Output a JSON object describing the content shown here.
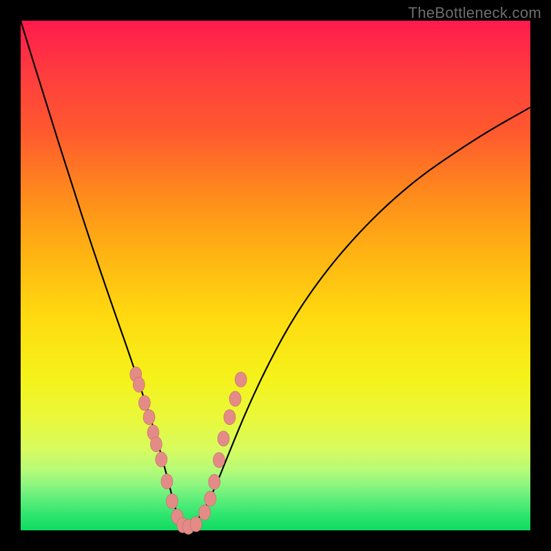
{
  "watermark": "TheBottleneck.com",
  "colors": {
    "frame": "#000000",
    "curve": "#000000",
    "marker_fill": "#e58b87",
    "marker_stroke": "#b66e6a",
    "gradient_top": "#ff1a4d",
    "gradient_bottom": "#0fdb61"
  },
  "chart_data": {
    "type": "line",
    "title": "",
    "xlabel": "",
    "ylabel": "",
    "x_range": [
      0,
      1
    ],
    "y_range": [
      0,
      1
    ],
    "series": [
      {
        "name": "bottleneck-curve",
        "x": [
          0.0,
          0.05,
          0.1,
          0.14,
          0.18,
          0.21,
          0.232,
          0.25,
          0.265,
          0.278,
          0.29,
          0.3,
          0.31,
          0.32,
          0.335,
          0.355,
          0.38,
          0.41,
          0.445,
          0.49,
          0.54,
          0.6,
          0.66,
          0.72,
          0.785,
          0.85,
          0.92,
          1.0
        ],
        "y": [
          1.0,
          0.838,
          0.68,
          0.557,
          0.44,
          0.355,
          0.29,
          0.235,
          0.187,
          0.14,
          0.095,
          0.055,
          0.022,
          0.008,
          0.008,
          0.03,
          0.08,
          0.155,
          0.24,
          0.335,
          0.425,
          0.51,
          0.58,
          0.64,
          0.695,
          0.74,
          0.785,
          0.83
        ]
      }
    ],
    "markers": {
      "name": "highlight-points",
      "x": [
        0.226,
        0.232,
        0.243,
        0.252,
        0.26,
        0.266,
        0.276,
        0.287,
        0.297,
        0.307,
        0.318,
        0.329,
        0.344,
        0.361,
        0.372,
        0.38,
        0.389,
        0.398,
        0.41,
        0.421,
        0.432
      ],
      "y": [
        0.306,
        0.286,
        0.25,
        0.222,
        0.192,
        0.169,
        0.139,
        0.096,
        0.057,
        0.027,
        0.01,
        0.007,
        0.012,
        0.035,
        0.062,
        0.095,
        0.138,
        0.18,
        0.222,
        0.258,
        0.296
      ]
    }
  }
}
